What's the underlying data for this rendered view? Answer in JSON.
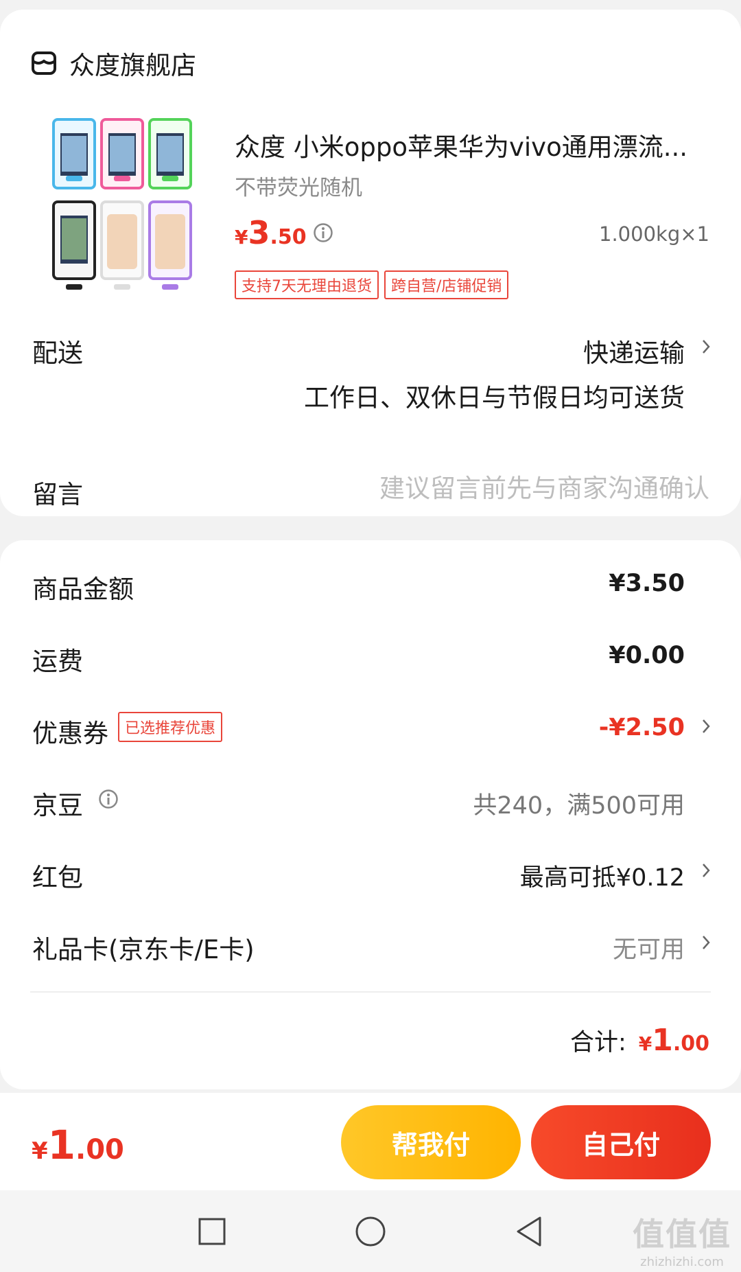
{
  "store": {
    "name": "众度旗舰店",
    "icon": "store-icon"
  },
  "product": {
    "title": "众度 小米oppo苹果华为vivo通用漂流...",
    "variant": "不带荧光随机",
    "price": {
      "currency": "¥",
      "integer": "3",
      "decimal": ".50"
    },
    "quantity": "1.000kg×1",
    "tags": [
      "支持7天无理由退货",
      "跨自营/店铺促销"
    ]
  },
  "delivery": {
    "label": "配送",
    "method": "快递运输",
    "description": "工作日、双休日与节假日均可送货"
  },
  "message": {
    "label": "留言",
    "placeholder": "建议留言前先与商家沟通确认"
  },
  "summary": {
    "goods_amount": {
      "label": "商品金额",
      "value": "¥3.50"
    },
    "shipping": {
      "label": "运费",
      "value": "¥0.00"
    },
    "coupon": {
      "label": "优惠券",
      "badge": "已选推荐优惠",
      "value": "-¥2.50"
    },
    "jingdou": {
      "label": "京豆",
      "value": "共240，满500可用"
    },
    "red_packet": {
      "label": "红包",
      "value": "最高可抵¥0.12"
    },
    "gift_card": {
      "label": "礼品卡(京东卡/E卡)",
      "value": "无可用"
    },
    "total": {
      "label": "合计:",
      "currency": "¥",
      "integer": "1",
      "decimal": ".00"
    }
  },
  "paybar": {
    "price": {
      "currency": "¥",
      "integer": "1",
      "decimal": ".00"
    },
    "help_pay_label": "帮我付",
    "self_pay_label": "自己付"
  },
  "watermark": {
    "logo": "值值值",
    "url": "zhizhizhi.com"
  },
  "colors": {
    "accent_red": "#e93323",
    "yellow_button": "#ffbe1a",
    "red_button": "#f03c22"
  }
}
